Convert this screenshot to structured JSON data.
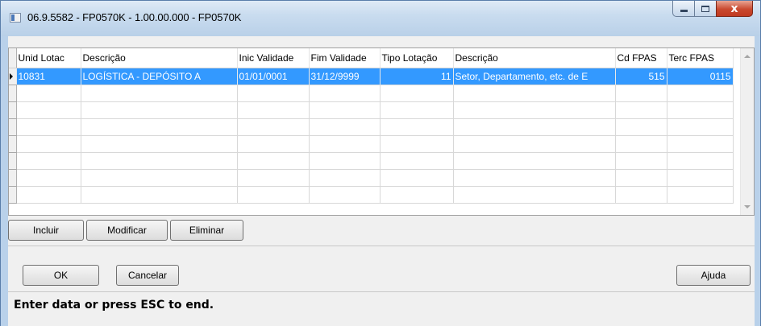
{
  "window": {
    "title": "06.9.5582 - FP0570K - 1.00.00.000 - FP0570K",
    "icons": {
      "app": "app-window-icon",
      "minimize": "minimize-icon",
      "maximize": "maximize-icon",
      "close": "close-icon"
    }
  },
  "grid": {
    "columns": [
      "Unid Lotac",
      "Descrição",
      "Inic Validade",
      "Fim Validade",
      "Tipo Lotação",
      "Descrição",
      "Cd FPAS",
      "Terc FPAS"
    ],
    "rows": [
      {
        "unid_lotac": "10831",
        "descricao": "LOGÍSTICA - DEPÓSITO A",
        "inic_validade": "01/01/0001",
        "fim_validade": "31/12/9999",
        "tipo_lotacao": "11",
        "descricao2": "Setor, Departamento, etc. de E",
        "cd_fpas": "515",
        "terc_fpas": "0115"
      }
    ],
    "selection_color": "#3399ff"
  },
  "grid_buttons": {
    "incluir": "Incluir",
    "modificar": "Modificar",
    "eliminar": "Eliminar"
  },
  "dialog_buttons": {
    "ok": "OK",
    "cancelar": "Cancelar",
    "ajuda": "Ajuda"
  },
  "status_bar": {
    "text": "Enter data or press ESC to end."
  }
}
